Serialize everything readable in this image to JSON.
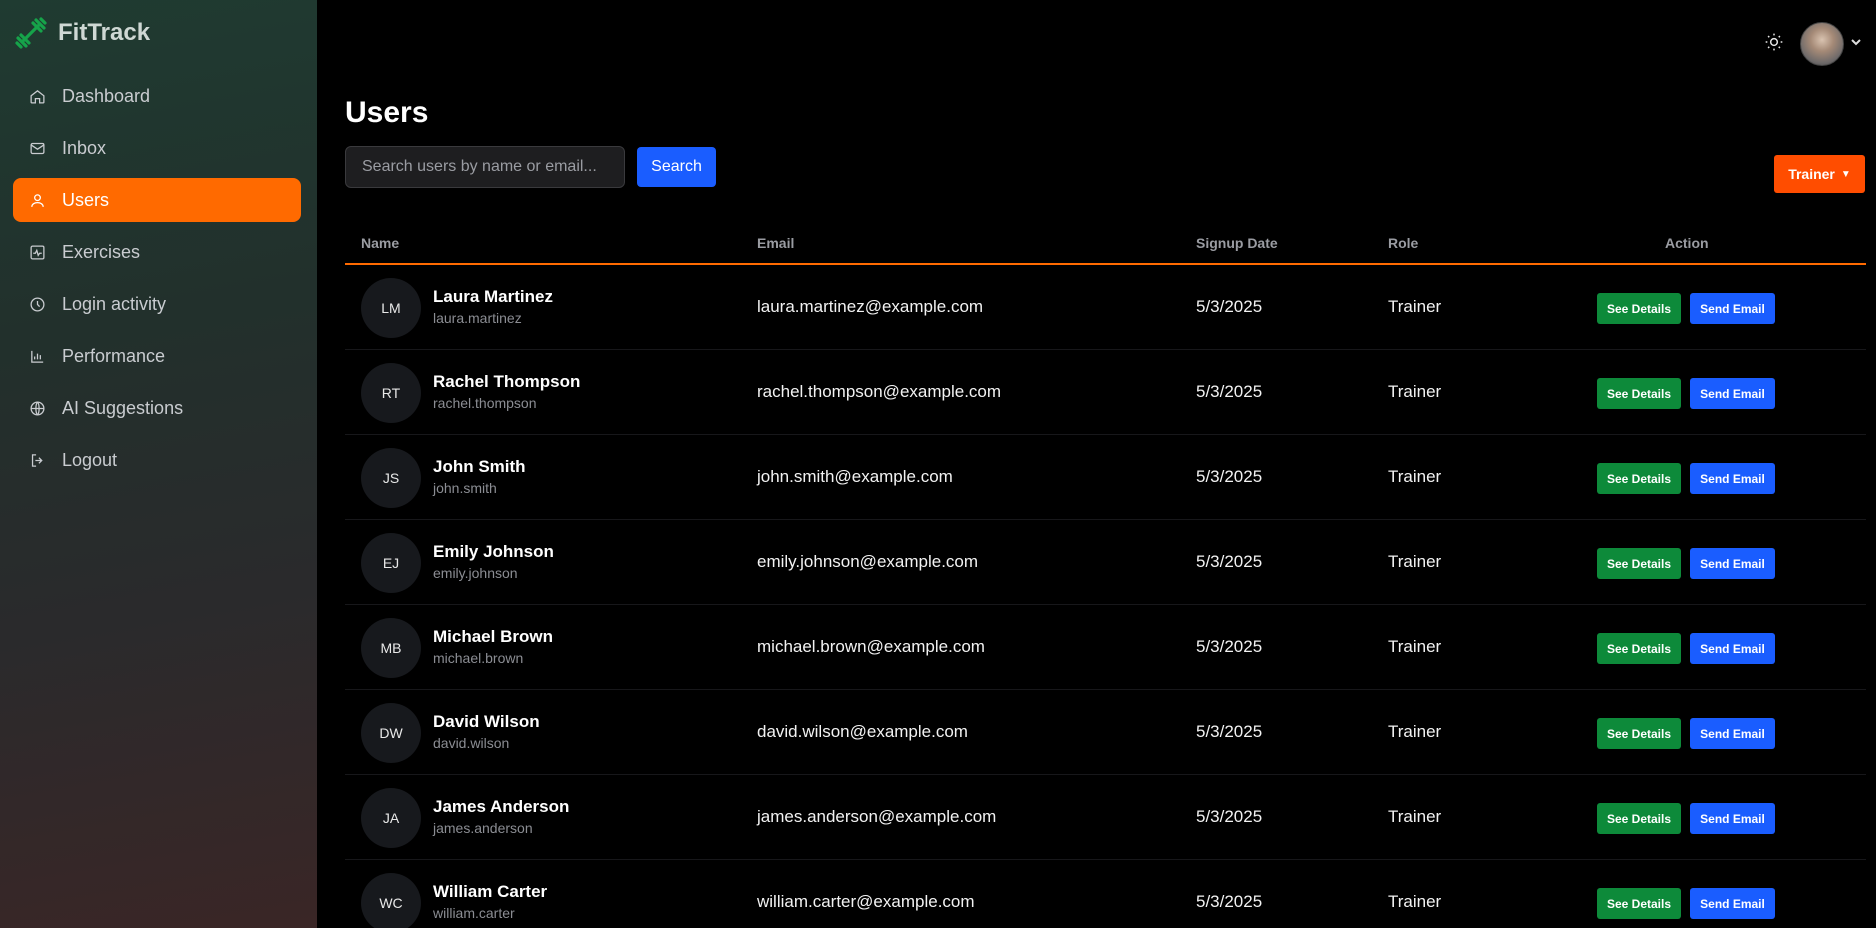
{
  "sidebar": {
    "brand": "FitTrack",
    "items": [
      {
        "label": "Dashboard",
        "icon": "home-icon",
        "active": false
      },
      {
        "label": "Inbox",
        "icon": "mail-icon",
        "active": false
      },
      {
        "label": "Users",
        "icon": "user-icon",
        "active": true
      },
      {
        "label": "Exercises",
        "icon": "activity-icon",
        "active": false
      },
      {
        "label": "Login activity",
        "icon": "clock-icon",
        "active": false
      },
      {
        "label": "Performance",
        "icon": "bar-chart-icon",
        "active": false
      },
      {
        "label": "AI Suggestions",
        "icon": "globe-icon",
        "active": false
      },
      {
        "label": "Logout",
        "icon": "logout-icon",
        "active": false
      }
    ]
  },
  "header": {
    "theme_icon": "sun-icon",
    "avatar_icon": "user-avatar"
  },
  "main": {
    "title": "Users",
    "search": {
      "placeholder": "Search users by name or email...",
      "value": ""
    },
    "search_button": "Search",
    "role_filter": "Trainer",
    "columns": [
      "Name",
      "Email",
      "Signup Date",
      "Role",
      "Action"
    ],
    "actions": {
      "details": "See Details",
      "email": "Send Email"
    },
    "rows": [
      {
        "initials": "LM",
        "name": "Laura Martinez",
        "handle": "laura.martinez",
        "email": "laura.martinez@example.com",
        "date": "5/3/2025",
        "role": "Trainer"
      },
      {
        "initials": "RT",
        "name": "Rachel Thompson",
        "handle": "rachel.thompson",
        "email": "rachel.thompson@example.com",
        "date": "5/3/2025",
        "role": "Trainer"
      },
      {
        "initials": "JS",
        "name": "John Smith",
        "handle": "john.smith",
        "email": "john.smith@example.com",
        "date": "5/3/2025",
        "role": "Trainer"
      },
      {
        "initials": "EJ",
        "name": "Emily Johnson",
        "handle": "emily.johnson",
        "email": "emily.johnson@example.com",
        "date": "5/3/2025",
        "role": "Trainer"
      },
      {
        "initials": "MB",
        "name": "Michael Brown",
        "handle": "michael.brown",
        "email": "michael.brown@example.com",
        "date": "5/3/2025",
        "role": "Trainer"
      },
      {
        "initials": "DW",
        "name": "David Wilson",
        "handle": "david.wilson",
        "email": "david.wilson@example.com",
        "date": "5/3/2025",
        "role": "Trainer"
      },
      {
        "initials": "JA",
        "name": "James Anderson",
        "handle": "james.anderson",
        "email": "james.anderson@example.com",
        "date": "5/3/2025",
        "role": "Trainer"
      },
      {
        "initials": "WC",
        "name": "William Carter",
        "handle": "william.carter",
        "email": "william.carter@example.com",
        "date": "5/3/2025",
        "role": "Trainer"
      }
    ]
  },
  "colors": {
    "accent": "#ff6a00",
    "filter": "#ff4d00",
    "primary": "#1a5dff",
    "success": "#0d8a3a",
    "brand_logo": "#16a34a"
  }
}
